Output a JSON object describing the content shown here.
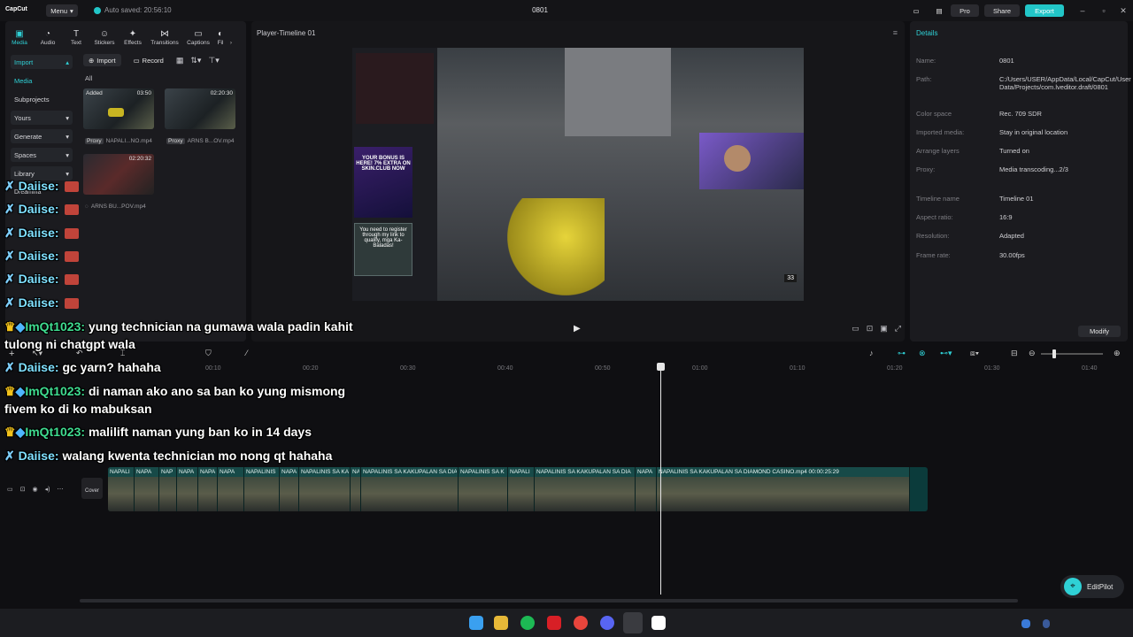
{
  "titlebar": {
    "logo": "CapCut",
    "menu_label": "Menu",
    "autosave": "Auto saved: 20:56:10",
    "project_title": "0801",
    "pro_label": "Pro",
    "share_label": "Share",
    "export_label": "Export"
  },
  "media_tabs": [
    {
      "label": "Media",
      "icon": "media-icon"
    },
    {
      "label": "Audio",
      "icon": "audio-icon"
    },
    {
      "label": "Text",
      "icon": "text-icon"
    },
    {
      "label": "Stickers",
      "icon": "stickers-icon"
    },
    {
      "label": "Effects",
      "icon": "effects-icon"
    },
    {
      "label": "Transitions",
      "icon": "transitions-icon"
    },
    {
      "label": "Captions",
      "icon": "captions-icon"
    },
    {
      "label": "Fil",
      "icon": "filters-icon"
    }
  ],
  "side_nav": {
    "import": "Import",
    "media": "Media",
    "subprojects": "Subprojects",
    "yours": "Yours",
    "generate": "Generate",
    "spaces": "Spaces",
    "library": "Library",
    "dreamina": "Dreamina"
  },
  "media_toolbar": {
    "import_label": "Import",
    "record_label": "Record",
    "filter_all": "All"
  },
  "media_items": [
    {
      "tag": "Added",
      "duration": "03:50",
      "proxy": "Proxy",
      "name": "NAPALI...NO.mp4"
    },
    {
      "tag": "",
      "duration": "02:20:30",
      "proxy": "Proxy",
      "name": "ARNS B...OV.mp4"
    },
    {
      "tag": "",
      "duration": "02:20:32",
      "proxy": "",
      "name": "ARNS BU...POV.mp4"
    }
  ],
  "player": {
    "title": "Player-Timeline 01",
    "promo_text": "YOUR BONUS IS HERE! 7% EXTRA ON SKIN.CLUB NOW",
    "promo2_text": "You need to register through my link to qualify, mga Ka-Baladas!",
    "hud_count": "33"
  },
  "details": {
    "title": "Details",
    "rows": [
      {
        "k": "Name:",
        "v": "0801"
      },
      {
        "k": "Path:",
        "v": "C:/Users/USER/AppData/Local/CapCut/User Data/Projects/com.lveditor.draft/0801"
      },
      {
        "k": "Color space",
        "v": "Rec. 709 SDR"
      },
      {
        "k": "Imported media:",
        "v": "Stay in original location"
      },
      {
        "k": "Arrange layers",
        "v": "Turned on"
      },
      {
        "k": "Proxy:",
        "v": "Media transcoding...2/3"
      },
      {
        "k": "Timeline name",
        "v": "Timeline 01"
      },
      {
        "k": "Aspect ratio:",
        "v": "16:9"
      },
      {
        "k": "Resolution:",
        "v": "Adapted"
      },
      {
        "k": "Frame rate:",
        "v": "30.00fps"
      }
    ],
    "modify_label": "Modify"
  },
  "ruler_ticks": [
    "00:10",
    "00:20",
    "00:30",
    "00:40",
    "00:50",
    "01:00",
    "01:10",
    "01:20",
    "01:30",
    "01:40"
  ],
  "cover_label": "Cover",
  "clips": [
    {
      "label": "NAPALI"
    },
    {
      "label": "NAPA"
    },
    {
      "label": "NAP"
    },
    {
      "label": "NAPA"
    },
    {
      "label": "NAPA"
    },
    {
      "label": "NAPA"
    },
    {
      "label": "NAPALINIS"
    },
    {
      "label": "NAPA"
    },
    {
      "label": "NAPALINIS SA KA"
    },
    {
      "label": "NA"
    },
    {
      "label": "NAPALINIS SA KAKUPALAN SA DIA"
    },
    {
      "label": "NAPALINIS SA K"
    },
    {
      "label": "NAPALI"
    },
    {
      "label": "NAPALINIS SA KAKUPALAN SA DIA"
    },
    {
      "label": "NAPA"
    },
    {
      "label": "NAPALINIS SA KAKUPALAN SA DIAMOND CASINO.mp4   00:00:25:29"
    }
  ],
  "editpilot_label": "EditPilot",
  "chat": [
    {
      "name": "Daiise:",
      "msg": "",
      "kind": "d"
    },
    {
      "name": "Daiise:",
      "msg": "",
      "kind": "d"
    },
    {
      "name": "Daiise:",
      "msg": "",
      "kind": "d"
    },
    {
      "name": "Daiise:",
      "msg": "",
      "kind": "d"
    },
    {
      "name": "Daiise:",
      "msg": "",
      "kind": "d"
    },
    {
      "name": "Daiise:",
      "msg": "",
      "kind": "d"
    },
    {
      "name": "ImQt1023:",
      "msg": "yung technician na gumawa wala padin kahit",
      "kind": "q"
    },
    {
      "name": "",
      "msg": "tulong ni chatgpt wala",
      "kind": "cont"
    },
    {
      "name": "Daiise:",
      "msg": "gc yarn? hahaha",
      "kind": "d"
    },
    {
      "name": "ImQt1023:",
      "msg": "di naman ako ano sa ban ko yung mismong",
      "kind": "q"
    },
    {
      "name": "",
      "msg": "fivem ko di ko mabuksan",
      "kind": "cont"
    },
    {
      "name": "ImQt1023:",
      "msg": "malilift naman yung ban ko in 14 days",
      "kind": "q"
    },
    {
      "name": "Daiise:",
      "msg": "walang kwenta technician mo nong qt hahaha",
      "kind": "d"
    }
  ]
}
